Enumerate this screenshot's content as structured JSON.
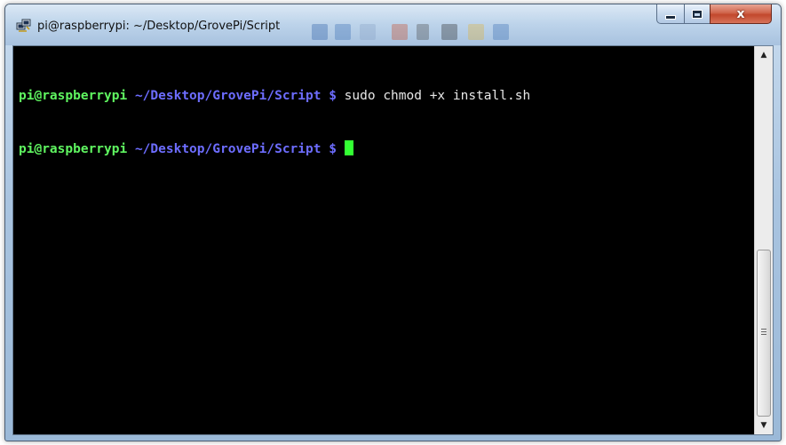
{
  "window": {
    "title": "pi@raspberrypi: ~/Desktop/GrovePi/Script",
    "app_icon": "putty-terminal-icon",
    "buttons": {
      "minimize_icon": "minimize-icon",
      "maximize_icon": "maximize-icon",
      "close_icon": "close-icon",
      "close_glyph": "x"
    }
  },
  "terminal": {
    "colors": {
      "background": "#000000",
      "user": "#5ff560",
      "path": "#6d6dff",
      "text": "#e8e8e8",
      "cursor": "#33ff33"
    },
    "lines": [
      {
        "user": "pi@raspberrypi",
        "path": "~/Desktop/GrovePi/Script",
        "prompt": "$",
        "command": "sudo chmod +x install.sh"
      },
      {
        "user": "pi@raspberrypi",
        "path": "~/Desktop/GrovePi/Script",
        "prompt": "$",
        "command": ""
      }
    ]
  },
  "scrollbar": {
    "up_icon": "arrow-up-icon",
    "down_icon": "arrow-down-icon",
    "thumb_position_fraction": 0.55
  }
}
